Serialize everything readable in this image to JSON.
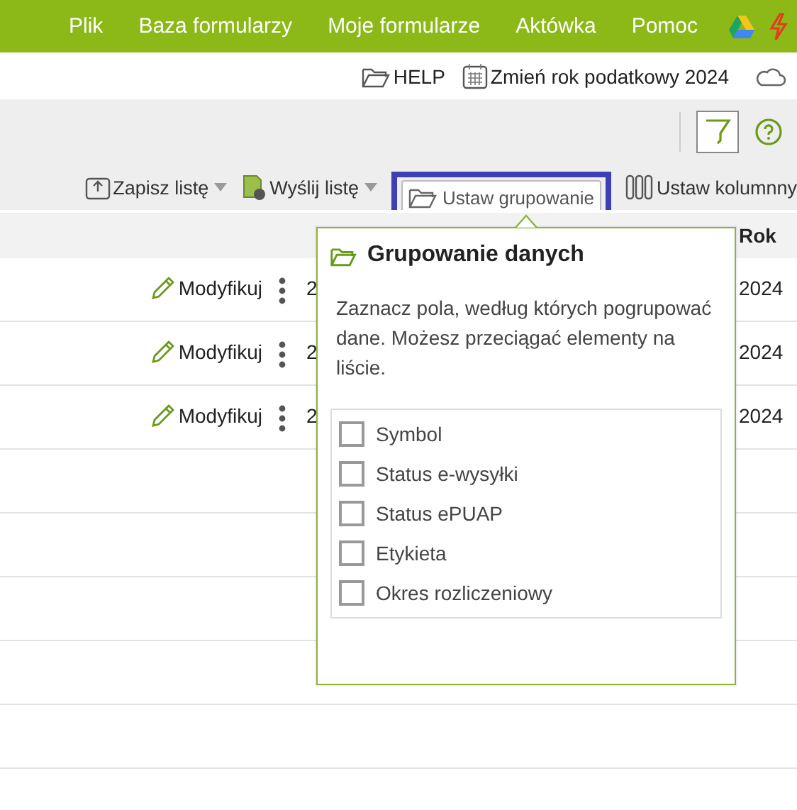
{
  "menu": [
    "Plik",
    "Baza formularzy",
    "Moje formularze",
    "Aktówka",
    "Pomoc"
  ],
  "top_links": [
    {
      "kind": "folder",
      "label": "HELP"
    },
    {
      "kind": "calendar",
      "label": "Zmień rok podatkowy 2024"
    }
  ],
  "toolbar": [
    {
      "kind": "save",
      "label": "Zapisz listę",
      "dropdown": true,
      "selected": false
    },
    {
      "kind": "send",
      "label": "Wyślij listę",
      "dropdown": true,
      "selected": false
    },
    {
      "kind": "group",
      "label": "Ustaw grupowanie",
      "dropdown": false,
      "selected": true
    },
    {
      "kind": "columns",
      "label": "Ustaw kolumnny",
      "dropdown": false,
      "selected": false
    }
  ],
  "table": {
    "columns": [
      "Rok"
    ],
    "rows": [
      {
        "action": "Modyfikuj",
        "column_1": "2",
        "rok": "2024"
      },
      {
        "action": "Modyfikuj",
        "column_1": "2",
        "rok": "2024"
      },
      {
        "action": "Modyfikuj",
        "column_1": "2",
        "rok": "2024"
      }
    ]
  },
  "popup": {
    "title": "Grupowanie danych",
    "description": "Zaznacz pola, według których pogrupować dane. Możesz przeciągać elementy na liście.",
    "options": [
      {
        "label": "Symbol",
        "checked": false
      },
      {
        "label": "Status e-wysyłki",
        "checked": false
      },
      {
        "label": "Status ePUAP",
        "checked": false
      },
      {
        "label": "Etykieta",
        "checked": false
      },
      {
        "label": "Okres rozliczeniowy",
        "checked": false
      }
    ]
  }
}
